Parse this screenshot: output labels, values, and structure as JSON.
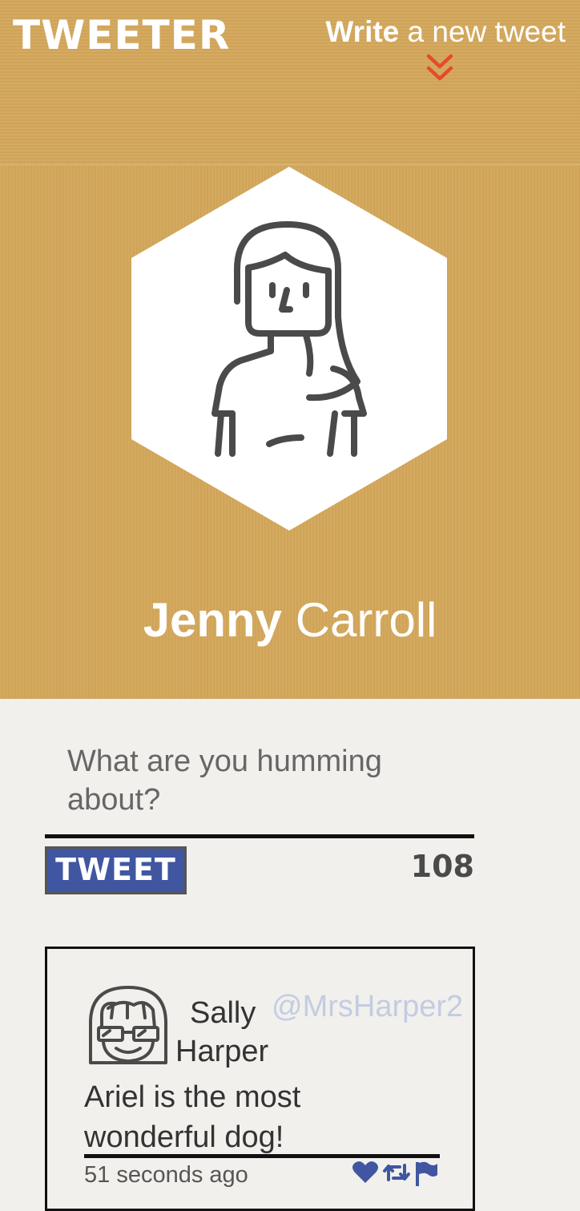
{
  "nav": {
    "logo": "TWEETER",
    "compose_bold": "Write",
    "compose_rest": " a new tweet",
    "chevron_icon": "double-chevron-down-icon",
    "chevron_color": "#e64a2e"
  },
  "profile": {
    "avatar_icon": "woman-avatar-icon",
    "first_name": "Jenny",
    "last_name": " Carroll"
  },
  "composer": {
    "placeholder": "What are you humming about?",
    "value": "",
    "button_label": "TWEET",
    "char_count": "108"
  },
  "tweets": [
    {
      "author_first": "Sally",
      "author_last": "Harper",
      "handle": "@MrsHarper2",
      "text": "Ariel is the most wonderful dog!",
      "time": "51 seconds ago",
      "avatar_icon": "girl-with-glasses-avatar-icon",
      "actions": [
        "heart-icon",
        "retweet-icon",
        "flag-icon"
      ]
    }
  ],
  "colors": {
    "banner": "#d3a75b",
    "page_bg": "#f1f0ec",
    "button": "#4056a1",
    "handle": "#c3cce1",
    "action_icons": "#4056a1"
  }
}
